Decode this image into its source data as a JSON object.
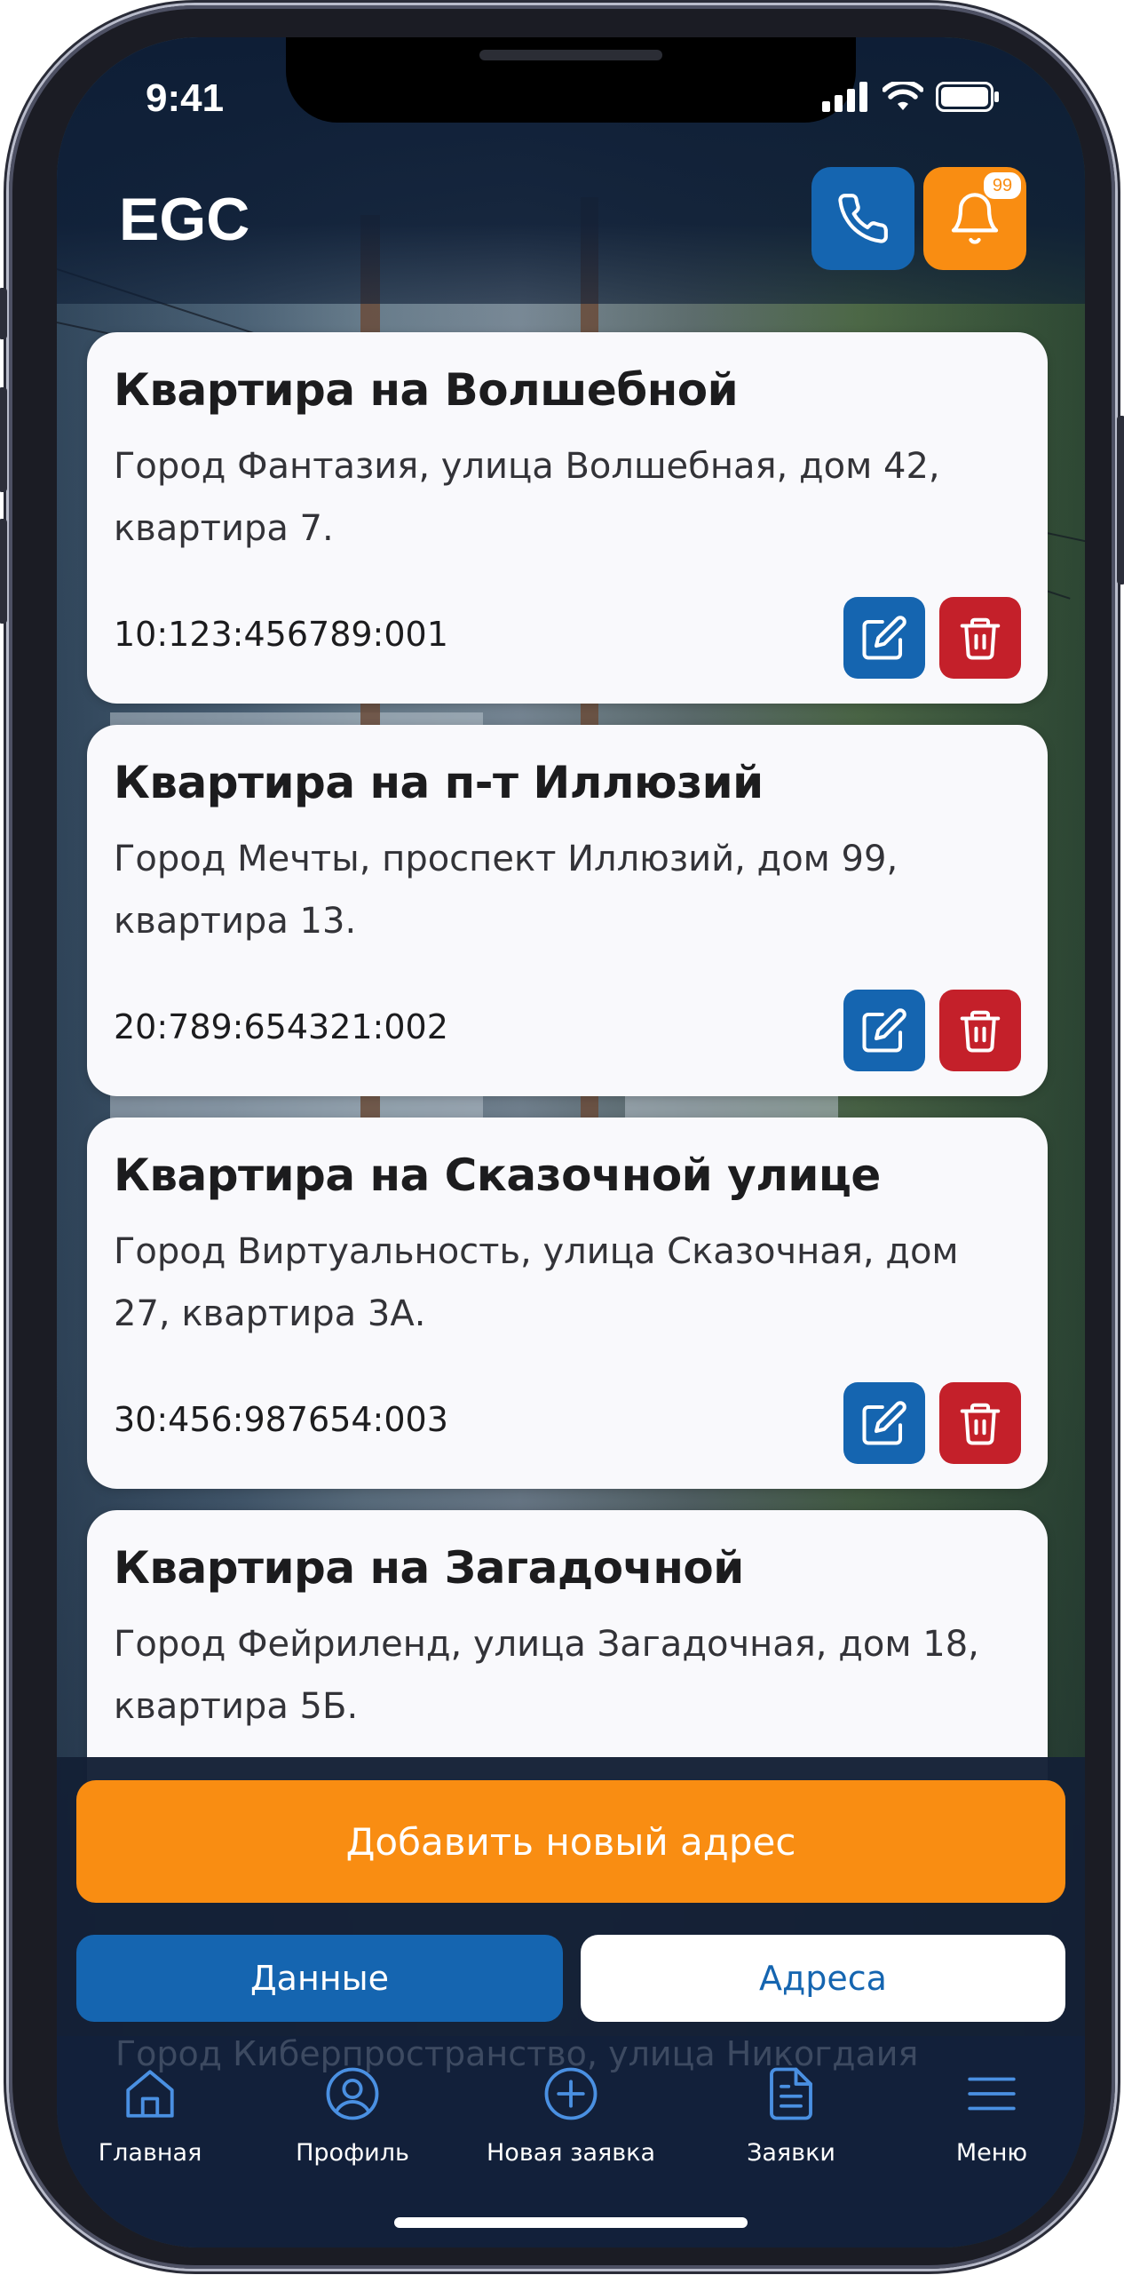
{
  "status_bar": {
    "time": "9:41"
  },
  "header": {
    "title": "EGC",
    "notifications_badge": "99",
    "colors": {
      "primary": "#1565b0",
      "accent": "#f98d12",
      "danger": "#c4202a",
      "header_bg": "#0e1e36"
    }
  },
  "addresses": [
    {
      "title": "Квартира на Волшебной",
      "address": "Город Фантазия, улица Волшебная, дом 42, квартира 7.",
      "code": "10:123:456789:001"
    },
    {
      "title": "Квартира на п-т Иллюзий",
      "address": "Город Мечты, проспект Иллюзий, дом 99, квартира 13.",
      "code": "20:789:654321:002"
    },
    {
      "title": "Квартира на Сказочной улице",
      "address": "Город Виртуальность, улица Сказочная, дом 27, квартира 3А.",
      "code": "30:456:987654:003"
    },
    {
      "title": "Квартира на Загадочной",
      "address": "Город Фейриленд, улица Загадочная, дом 18, квартира 5Б."
    }
  ],
  "actions": {
    "add_address": "Добавить новый адрес"
  },
  "segments": {
    "data": "Данные",
    "addresses": "Адреса",
    "selected": "Адреса"
  },
  "partially_hidden_text": "Город Киберпространство, улица Никогдаия",
  "tabbar": {
    "items": [
      {
        "label": "Главная",
        "icon": "home-icon"
      },
      {
        "label": "Профиль",
        "icon": "profile-icon"
      },
      {
        "label": "Новая заявка",
        "icon": "plus-circle-icon"
      },
      {
        "label": "Заявки",
        "icon": "document-icon"
      },
      {
        "label": "Меню",
        "icon": "menu-icon"
      }
    ]
  }
}
